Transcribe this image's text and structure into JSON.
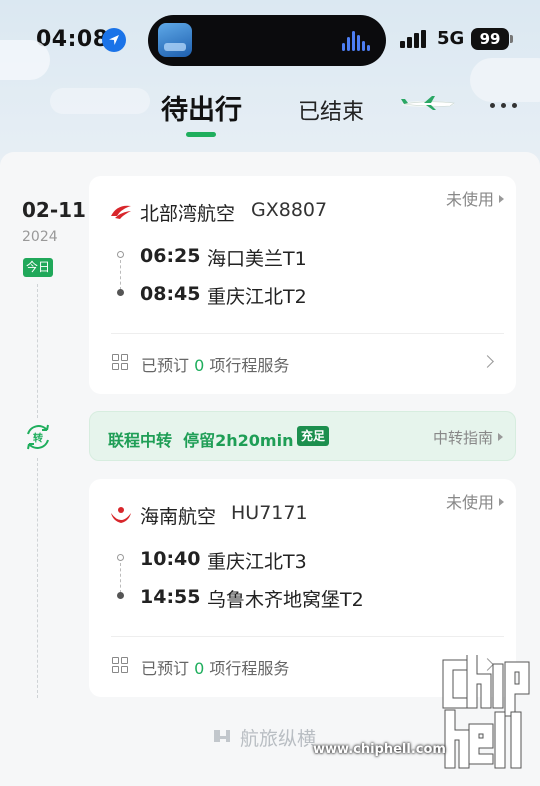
{
  "status_bar": {
    "time": "04:08",
    "network": "5G",
    "battery": "99"
  },
  "tabs": [
    {
      "label": "待出行",
      "active": true
    },
    {
      "label": "已结束",
      "active": false
    }
  ],
  "accent_color": "#1fae5d",
  "date": {
    "day": "02-11",
    "year": "2024",
    "badge": "今日"
  },
  "flights": [
    {
      "status": "未使用",
      "airline": "北部湾航空",
      "flight_no": "GX8807",
      "dep_time": "06:25",
      "dep_airport": "海口美兰T1",
      "arr_time": "08:45",
      "arr_airport": "重庆江北T2",
      "services_prefix": "已预订",
      "services_count": "0",
      "services_suffix": "项行程服务"
    },
    {
      "status": "未使用",
      "airline": "海南航空",
      "flight_no": "HU7171",
      "dep_time": "10:40",
      "dep_airport": "重庆江北T3",
      "arr_time": "14:55",
      "arr_airport": "乌鲁木齐地窝堡T2",
      "services_prefix": "已预订",
      "services_count": "0",
      "services_suffix": "项行程服务"
    }
  ],
  "transfer": {
    "icon_label": "转",
    "text": "联程中转  停留2h20min",
    "badge": "充足",
    "guide": "中转指南"
  },
  "footer": {
    "logo_text": "航旅纵横"
  },
  "watermark": {
    "url": "www.chiphell.com"
  }
}
